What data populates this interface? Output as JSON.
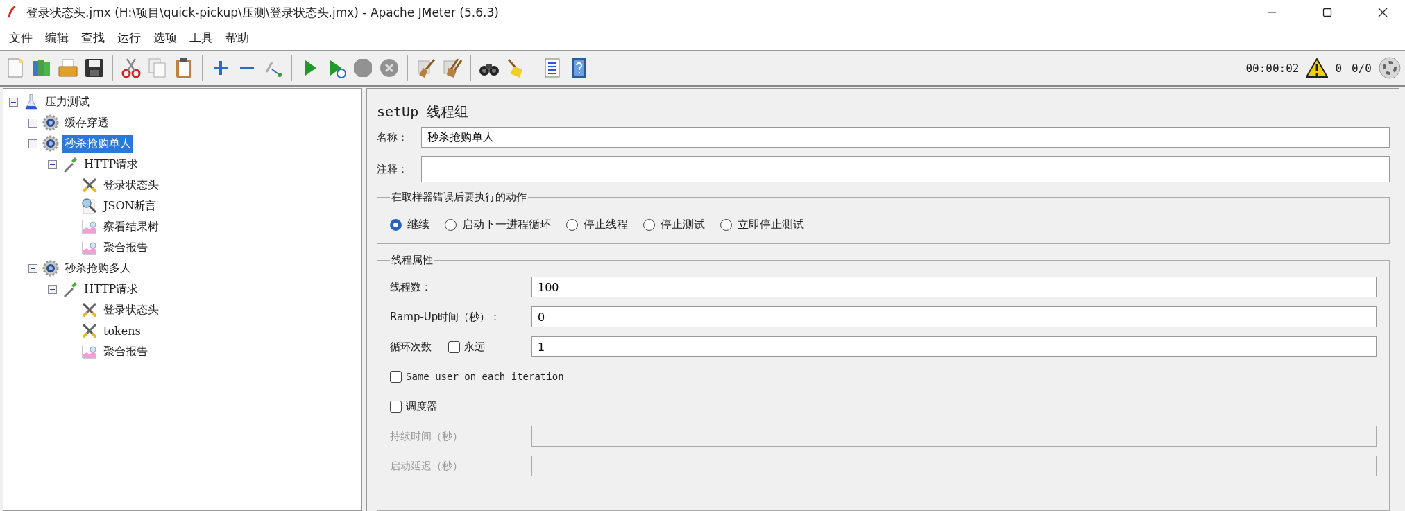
{
  "window": {
    "title": "登录状态头.jmx (H:\\项目\\quick-pickup\\压测\\登录状态头.jmx) - Apache JMeter (5.6.3)"
  },
  "menu": [
    "文件",
    "编辑",
    "查找",
    "运行",
    "选项",
    "工具",
    "帮助"
  ],
  "toolbar": [
    {
      "kind": "new",
      "disabled": false
    },
    {
      "kind": "templates",
      "disabled": false
    },
    {
      "kind": "open",
      "disabled": false
    },
    {
      "kind": "save",
      "disabled": false
    },
    {
      "kind": "separator"
    },
    {
      "kind": "cut",
      "disabled": false
    },
    {
      "kind": "copy",
      "disabled": false
    },
    {
      "kind": "paste",
      "disabled": false
    },
    {
      "kind": "separator"
    },
    {
      "kind": "expand",
      "disabled": false
    },
    {
      "kind": "collapse",
      "disabled": false
    },
    {
      "kind": "toggle",
      "disabled": false
    },
    {
      "kind": "separator"
    },
    {
      "kind": "start",
      "disabled": false
    },
    {
      "kind": "start-no-pause",
      "disabled": false
    },
    {
      "kind": "stop",
      "disabled": true
    },
    {
      "kind": "shutdown",
      "disabled": true
    },
    {
      "kind": "separator"
    },
    {
      "kind": "clear",
      "disabled": false
    },
    {
      "kind": "clear-all",
      "disabled": false
    },
    {
      "kind": "separator"
    },
    {
      "kind": "search",
      "disabled": false
    },
    {
      "kind": "reset-search",
      "disabled": false
    },
    {
      "kind": "separator"
    },
    {
      "kind": "function-helper",
      "disabled": false
    },
    {
      "kind": "help",
      "disabled": false
    }
  ],
  "status": {
    "elapsed": "00:00:02",
    "warnings": "0",
    "threads": "0/0"
  },
  "tree": [
    {
      "label": "压力测试",
      "kind": "plan",
      "expanded": true,
      "selected": false,
      "children": [
        {
          "label": "缓存穿透",
          "kind": "thread-group",
          "expanded": false,
          "selected": false,
          "has_children": true
        },
        {
          "label": "秒杀抢购单人",
          "kind": "thread-group",
          "expanded": true,
          "selected": true,
          "children": [
            {
              "label": "HTTP请求",
              "kind": "sampler",
              "expanded": true,
              "selected": false,
              "children": [
                {
                  "label": "登录状态头",
                  "kind": "config",
                  "selected": false
                },
                {
                  "label": "JSON断言",
                  "kind": "assertion",
                  "selected": false
                },
                {
                  "label": "察看结果树",
                  "kind": "listener",
                  "selected": false
                },
                {
                  "label": "聚合报告",
                  "kind": "listener",
                  "selected": false
                }
              ]
            }
          ]
        },
        {
          "label": "秒杀抢购多人",
          "kind": "thread-group",
          "expanded": true,
          "selected": false,
          "children": [
            {
              "label": "HTTP请求",
              "kind": "sampler",
              "expanded": true,
              "selected": false,
              "children": [
                {
                  "label": "登录状态头",
                  "kind": "config",
                  "selected": false
                },
                {
                  "label": "tokens",
                  "kind": "config",
                  "selected": false
                },
                {
                  "label": "聚合报告",
                  "kind": "listener",
                  "selected": false
                }
              ]
            }
          ]
        }
      ]
    }
  ],
  "panel": {
    "title": "setUp 线程组",
    "name": {
      "label": "名称：",
      "value": "秒杀抢购单人"
    },
    "comment": {
      "label": "注释："
    },
    "error_action": {
      "legend": "在取样器错误后要执行的动作",
      "options": [
        {
          "label": "继续",
          "selected": true
        },
        {
          "label": "启动下一进程循环",
          "selected": false
        },
        {
          "label": "停止线程",
          "selected": false
        },
        {
          "label": "停止测试",
          "selected": false
        },
        {
          "label": "立即停止测试",
          "selected": false
        }
      ]
    },
    "thread_properties": {
      "legend": "线程属性",
      "threads": {
        "label": "线程数：",
        "value": "100"
      },
      "ramp_up": {
        "label": "Ramp-Up时间（秒）：",
        "value": "0"
      },
      "loop": {
        "label": "循环次数",
        "forever": {
          "label": "永远",
          "checked": false
        },
        "value": "1"
      },
      "same_user": {
        "label": "Same user on each iteration",
        "checked": false
      },
      "scheduler": {
        "label": "调度器",
        "checked": false
      },
      "duration": {
        "label": "持续时间（秒）",
        "disabled": true
      },
      "delay": {
        "label": "启动延迟（秒）",
        "disabled": true
      }
    }
  }
}
